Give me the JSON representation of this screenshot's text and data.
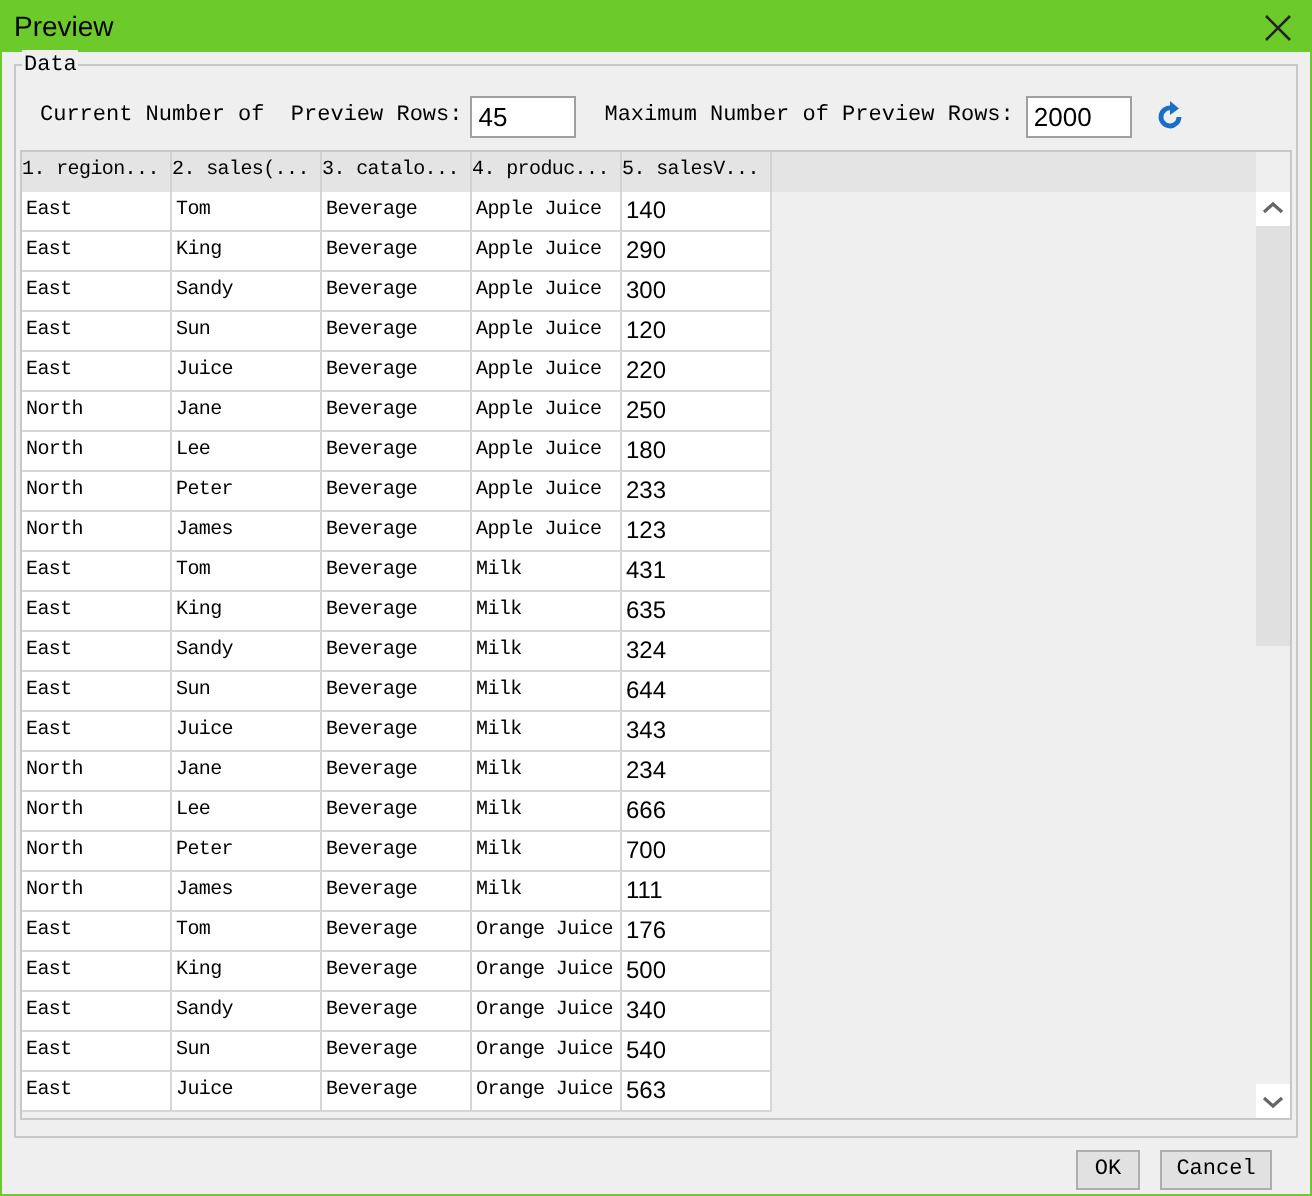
{
  "window": {
    "title": "Preview"
  },
  "group": {
    "label": "Data"
  },
  "current_rows": {
    "label": "Current Number of  Preview Rows:",
    "value": "45"
  },
  "max_rows": {
    "label": "Maximum Number of Preview Rows:",
    "value": "2000"
  },
  "table": {
    "columns": [
      "1. region...",
      "2. sales(...",
      "3. catalo...",
      "4. produc...",
      "5. salesV..."
    ],
    "rows": [
      [
        "East",
        "Tom",
        "Beverage",
        "Apple Juice",
        "140"
      ],
      [
        "East",
        "King",
        "Beverage",
        "Apple Juice",
        "290"
      ],
      [
        "East",
        "Sandy",
        "Beverage",
        "Apple Juice",
        "300"
      ],
      [
        "East",
        "Sun",
        "Beverage",
        "Apple Juice",
        "120"
      ],
      [
        "East",
        "Juice",
        "Beverage",
        "Apple Juice",
        "220"
      ],
      [
        "North",
        "Jane",
        "Beverage",
        "Apple Juice",
        "250"
      ],
      [
        "North",
        "Lee",
        "Beverage",
        "Apple Juice",
        "180"
      ],
      [
        "North",
        "Peter",
        "Beverage",
        "Apple Juice",
        "233"
      ],
      [
        "North",
        "James",
        "Beverage",
        "Apple Juice",
        "123"
      ],
      [
        "East",
        "Tom",
        "Beverage",
        "Milk",
        "431"
      ],
      [
        "East",
        "King",
        "Beverage",
        "Milk",
        "635"
      ],
      [
        "East",
        "Sandy",
        "Beverage",
        "Milk",
        "324"
      ],
      [
        "East",
        "Sun",
        "Beverage",
        "Milk",
        "644"
      ],
      [
        "East",
        "Juice",
        "Beverage",
        "Milk",
        "343"
      ],
      [
        "North",
        "Jane",
        "Beverage",
        "Milk",
        "234"
      ],
      [
        "North",
        "Lee",
        "Beverage",
        "Milk",
        "666"
      ],
      [
        "North",
        "Peter",
        "Beverage",
        "Milk",
        "700"
      ],
      [
        "North",
        "James",
        "Beverage",
        "Milk",
        "111"
      ],
      [
        "East",
        "Tom",
        "Beverage",
        "Orange Juice",
        "176"
      ],
      [
        "East",
        "King",
        "Beverage",
        "Orange Juice",
        "500"
      ],
      [
        "East",
        "Sandy",
        "Beverage",
        "Orange Juice",
        "340"
      ],
      [
        "East",
        "Sun",
        "Beverage",
        "Orange Juice",
        "540"
      ],
      [
        "East",
        "Juice",
        "Beverage",
        "Orange Juice",
        "563"
      ]
    ]
  },
  "buttons": [
    "OK",
    "Cancel"
  ]
}
